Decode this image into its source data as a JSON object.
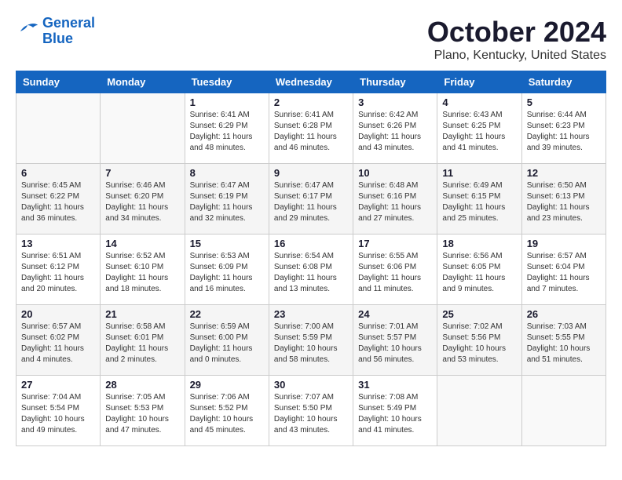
{
  "header": {
    "logo_line1": "General",
    "logo_line2": "Blue",
    "month_title": "October 2024",
    "location": "Plano, Kentucky, United States"
  },
  "days_of_week": [
    "Sunday",
    "Monday",
    "Tuesday",
    "Wednesday",
    "Thursday",
    "Friday",
    "Saturday"
  ],
  "weeks": [
    [
      {
        "day": "",
        "info": ""
      },
      {
        "day": "",
        "info": ""
      },
      {
        "day": "1",
        "info": "Sunrise: 6:41 AM\nSunset: 6:29 PM\nDaylight: 11 hours and 48 minutes."
      },
      {
        "day": "2",
        "info": "Sunrise: 6:41 AM\nSunset: 6:28 PM\nDaylight: 11 hours and 46 minutes."
      },
      {
        "day": "3",
        "info": "Sunrise: 6:42 AM\nSunset: 6:26 PM\nDaylight: 11 hours and 43 minutes."
      },
      {
        "day": "4",
        "info": "Sunrise: 6:43 AM\nSunset: 6:25 PM\nDaylight: 11 hours and 41 minutes."
      },
      {
        "day": "5",
        "info": "Sunrise: 6:44 AM\nSunset: 6:23 PM\nDaylight: 11 hours and 39 minutes."
      }
    ],
    [
      {
        "day": "6",
        "info": "Sunrise: 6:45 AM\nSunset: 6:22 PM\nDaylight: 11 hours and 36 minutes."
      },
      {
        "day": "7",
        "info": "Sunrise: 6:46 AM\nSunset: 6:20 PM\nDaylight: 11 hours and 34 minutes."
      },
      {
        "day": "8",
        "info": "Sunrise: 6:47 AM\nSunset: 6:19 PM\nDaylight: 11 hours and 32 minutes."
      },
      {
        "day": "9",
        "info": "Sunrise: 6:47 AM\nSunset: 6:17 PM\nDaylight: 11 hours and 29 minutes."
      },
      {
        "day": "10",
        "info": "Sunrise: 6:48 AM\nSunset: 6:16 PM\nDaylight: 11 hours and 27 minutes."
      },
      {
        "day": "11",
        "info": "Sunrise: 6:49 AM\nSunset: 6:15 PM\nDaylight: 11 hours and 25 minutes."
      },
      {
        "day": "12",
        "info": "Sunrise: 6:50 AM\nSunset: 6:13 PM\nDaylight: 11 hours and 23 minutes."
      }
    ],
    [
      {
        "day": "13",
        "info": "Sunrise: 6:51 AM\nSunset: 6:12 PM\nDaylight: 11 hours and 20 minutes."
      },
      {
        "day": "14",
        "info": "Sunrise: 6:52 AM\nSunset: 6:10 PM\nDaylight: 11 hours and 18 minutes."
      },
      {
        "day": "15",
        "info": "Sunrise: 6:53 AM\nSunset: 6:09 PM\nDaylight: 11 hours and 16 minutes."
      },
      {
        "day": "16",
        "info": "Sunrise: 6:54 AM\nSunset: 6:08 PM\nDaylight: 11 hours and 13 minutes."
      },
      {
        "day": "17",
        "info": "Sunrise: 6:55 AM\nSunset: 6:06 PM\nDaylight: 11 hours and 11 minutes."
      },
      {
        "day": "18",
        "info": "Sunrise: 6:56 AM\nSunset: 6:05 PM\nDaylight: 11 hours and 9 minutes."
      },
      {
        "day": "19",
        "info": "Sunrise: 6:57 AM\nSunset: 6:04 PM\nDaylight: 11 hours and 7 minutes."
      }
    ],
    [
      {
        "day": "20",
        "info": "Sunrise: 6:57 AM\nSunset: 6:02 PM\nDaylight: 11 hours and 4 minutes."
      },
      {
        "day": "21",
        "info": "Sunrise: 6:58 AM\nSunset: 6:01 PM\nDaylight: 11 hours and 2 minutes."
      },
      {
        "day": "22",
        "info": "Sunrise: 6:59 AM\nSunset: 6:00 PM\nDaylight: 11 hours and 0 minutes."
      },
      {
        "day": "23",
        "info": "Sunrise: 7:00 AM\nSunset: 5:59 PM\nDaylight: 10 hours and 58 minutes."
      },
      {
        "day": "24",
        "info": "Sunrise: 7:01 AM\nSunset: 5:57 PM\nDaylight: 10 hours and 56 minutes."
      },
      {
        "day": "25",
        "info": "Sunrise: 7:02 AM\nSunset: 5:56 PM\nDaylight: 10 hours and 53 minutes."
      },
      {
        "day": "26",
        "info": "Sunrise: 7:03 AM\nSunset: 5:55 PM\nDaylight: 10 hours and 51 minutes."
      }
    ],
    [
      {
        "day": "27",
        "info": "Sunrise: 7:04 AM\nSunset: 5:54 PM\nDaylight: 10 hours and 49 minutes."
      },
      {
        "day": "28",
        "info": "Sunrise: 7:05 AM\nSunset: 5:53 PM\nDaylight: 10 hours and 47 minutes."
      },
      {
        "day": "29",
        "info": "Sunrise: 7:06 AM\nSunset: 5:52 PM\nDaylight: 10 hours and 45 minutes."
      },
      {
        "day": "30",
        "info": "Sunrise: 7:07 AM\nSunset: 5:50 PM\nDaylight: 10 hours and 43 minutes."
      },
      {
        "day": "31",
        "info": "Sunrise: 7:08 AM\nSunset: 5:49 PM\nDaylight: 10 hours and 41 minutes."
      },
      {
        "day": "",
        "info": ""
      },
      {
        "day": "",
        "info": ""
      }
    ]
  ]
}
